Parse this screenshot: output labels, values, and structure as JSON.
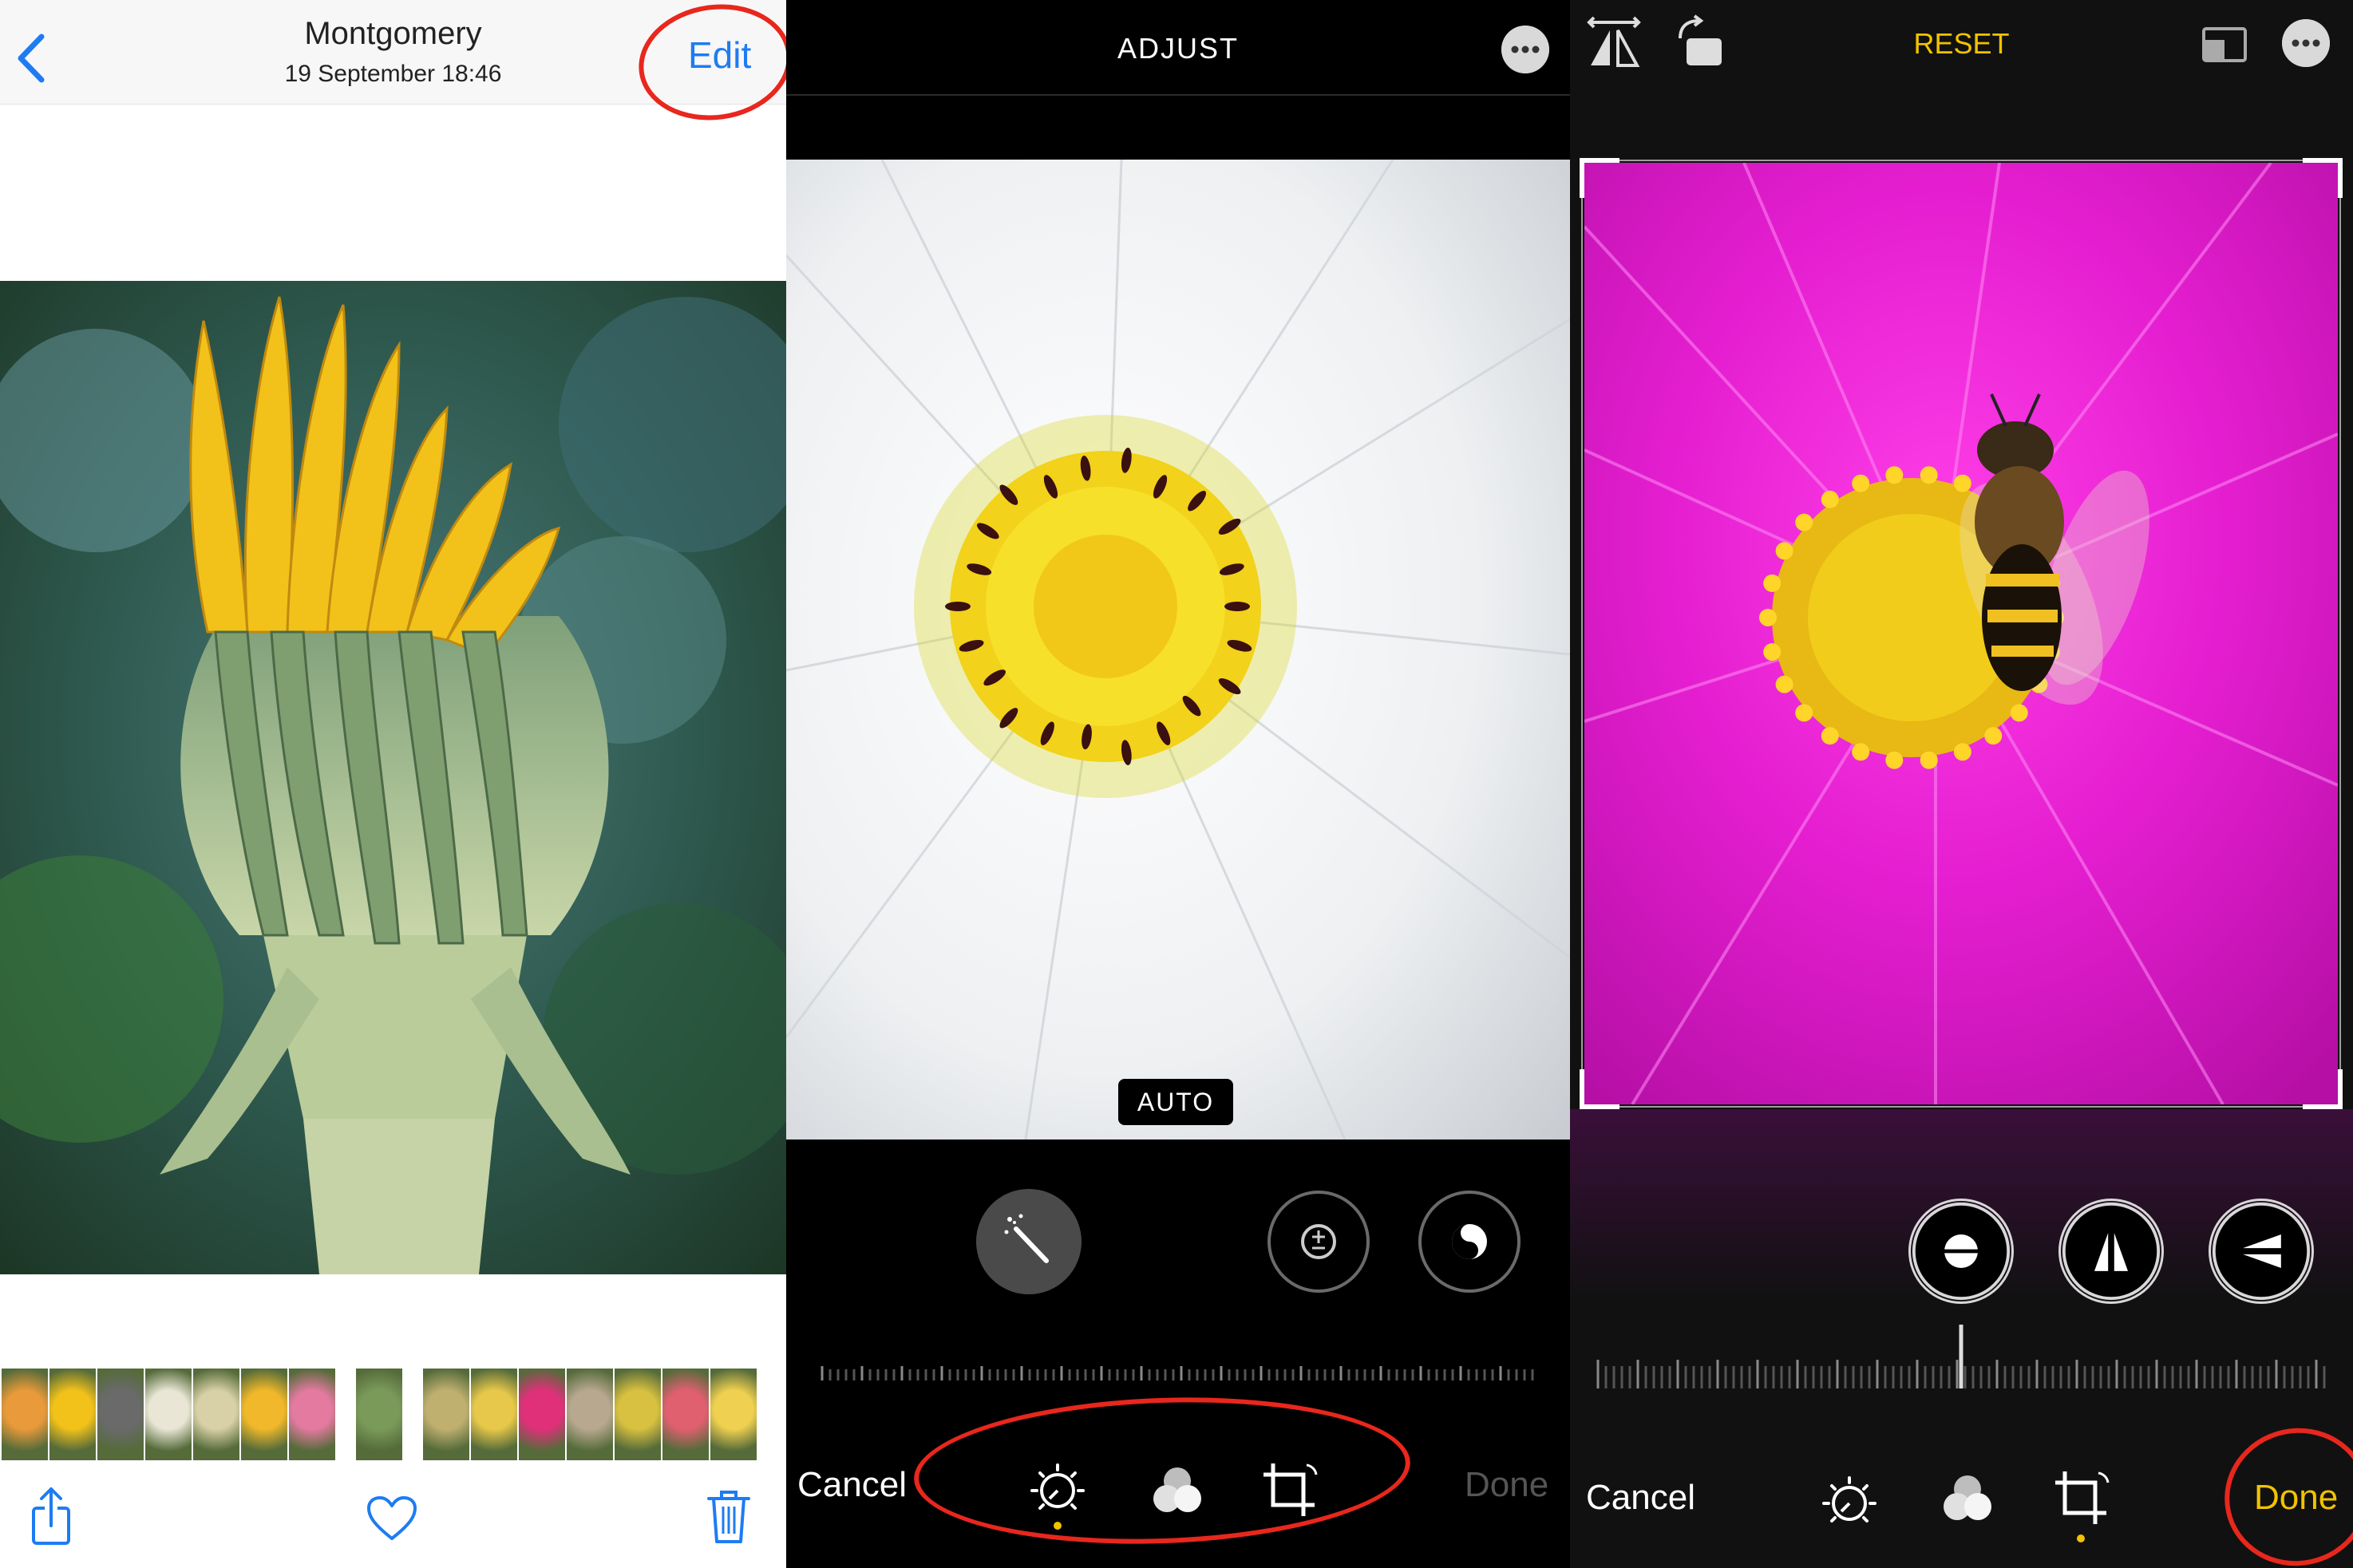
{
  "panel1": {
    "title": "Montgomery",
    "subtitle": "19 September  18:46",
    "edit_label": "Edit",
    "back_icon": "chevron-left-icon",
    "thumbnails": [
      "#e99a3a",
      "#f2c11a",
      "#6a6a6a",
      "#e9e6d5",
      "#d8d0a6",
      "#f0b82a",
      "#e47aa0",
      "#7a9a5a",
      "#c0b070",
      "#e8c84a",
      "#e0307a",
      "#b8a890",
      "#d8c040",
      "#e06070",
      "#f0d050"
    ],
    "toolbar": {
      "share_icon": "share-icon",
      "favorite_icon": "heart-icon",
      "delete_icon": "trash-icon"
    },
    "accent_color": "#1e7cf2"
  },
  "panel2": {
    "title": "ADJUST",
    "auto_label": "AUTO",
    "cancel_label": "Cancel",
    "done_label": "Done",
    "tools": [
      "auto-enhance-wand-icon",
      "exposure-icon",
      "brilliance-icon"
    ],
    "bottom_tabs": [
      "adjust-dial-icon",
      "filters-icon",
      "crop-icon"
    ]
  },
  "panel3": {
    "reset_label": "RESET",
    "cancel_label": "Cancel",
    "done_label": "Done",
    "top_icons": [
      "flip-horizontal-icon",
      "rotate-icon",
      "aspect-ratio-icon",
      "more-icon"
    ],
    "tools": [
      "straighten-icon",
      "vertical-perspective-icon",
      "horizontal-perspective-icon"
    ],
    "bottom_tabs": [
      "adjust-dial-icon",
      "filters-icon",
      "crop-icon"
    ],
    "accent_color": "#f2c200"
  },
  "annotation_color": "#e8271d"
}
